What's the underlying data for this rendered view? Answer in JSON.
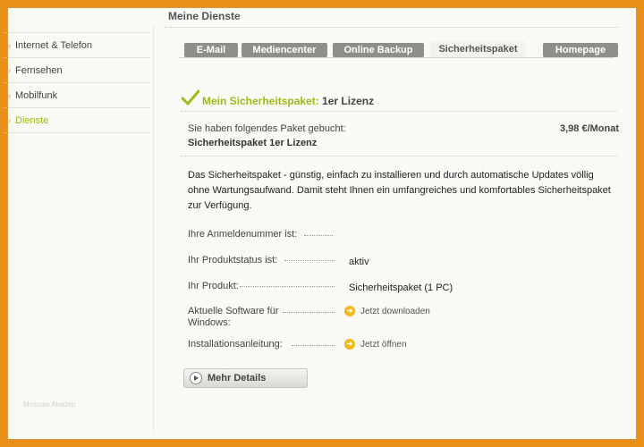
{
  "header": {
    "title": "Meine Dienste"
  },
  "sidebar": {
    "items": [
      {
        "label": "Internet & Telefon",
        "active": false
      },
      {
        "label": "Fernsehen",
        "active": false
      },
      {
        "label": "Mobilfunk",
        "active": false
      },
      {
        "label": "Dienste",
        "active": true
      }
    ],
    "footer_text": "Moscow Akadep"
  },
  "tabs": [
    {
      "label": "E-Mail",
      "active": false
    },
    {
      "label": "Mediencenter",
      "active": false
    },
    {
      "label": "Online Backup",
      "active": false
    },
    {
      "label": "Sicherheitspaket",
      "active": true
    },
    {
      "label": "Homepage",
      "active": false
    }
  ],
  "section": {
    "title_accent": "Mein Sicherheitspaket:",
    "title_rest": " 1er Lizenz"
  },
  "booking": {
    "intro": "Sie haben folgendes Paket gebucht:",
    "package_name": "Sicherheitspaket 1er Lizenz",
    "price": "3,98 €/Monat"
  },
  "description": "Das Sicherheitspaket - günstig, einfach zu installieren und durch automatische Updates völlig ohne Wartungsaufwand. Damit steht Ihnen ein umfangreiches und komfortables Sicherheitspaket zur Verfügung.",
  "details": {
    "login_label": "Ihre Anmeldenummer ist:",
    "status_label": "Ihr Produktstatus ist:",
    "status_value": "aktiv",
    "product_label": "Ihr Produkt:",
    "product_value": "Sicherheitspaket (1 PC)",
    "software_label": "Aktuelle Software für Windows:",
    "software_link": "Jetzt downloaden",
    "manual_label": "Installationsanleitung:",
    "manual_link": "Jetzt öffnen"
  },
  "button": {
    "more_details": "Mehr Details"
  },
  "colors": {
    "accent": "#9bbb1a",
    "frame": "#e8901a",
    "tab": "#8f8f89",
    "link_icon": "#f2b91c"
  },
  "icons": {
    "heading": "checkmark-icon",
    "link": "arrow-right-circle-icon",
    "button": "play-circle-icon"
  }
}
